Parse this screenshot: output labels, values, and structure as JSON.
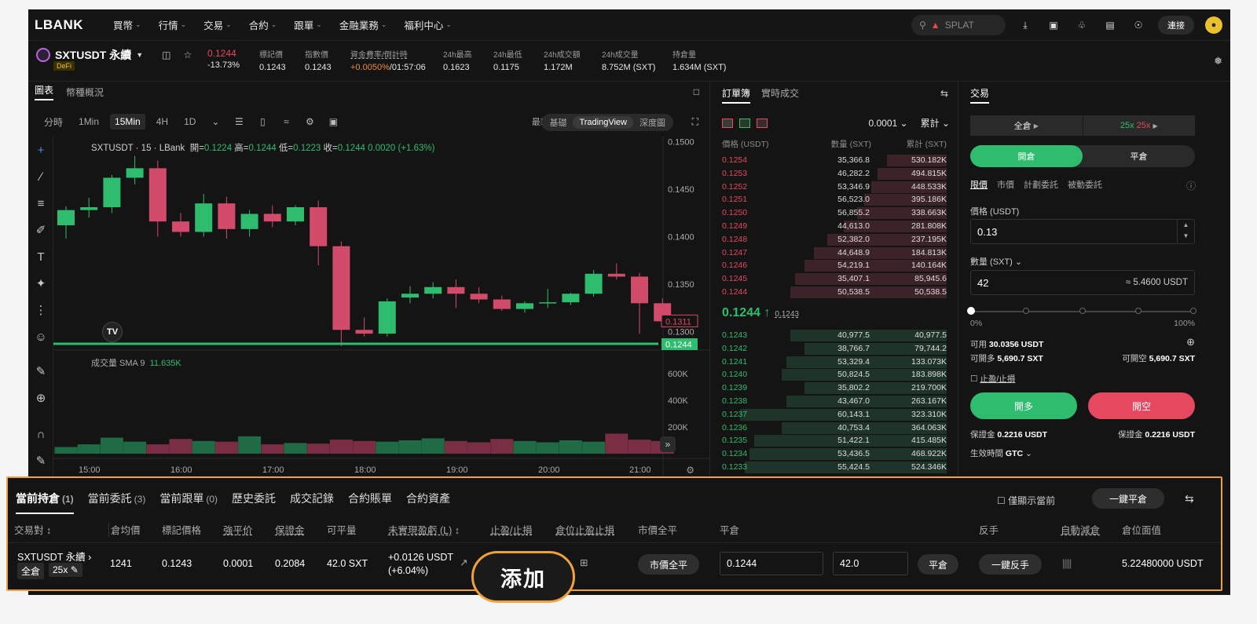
{
  "nav": {
    "logo": "LBANK",
    "items": [
      "買幣",
      "行情",
      "交易",
      "合約",
      "跟單",
      "金融業務",
      "福利中心"
    ],
    "search": "SPLAT",
    "connect": "連接"
  },
  "ticker": {
    "symbol": "SXTUSDT 永續",
    "badge": "DeFi",
    "price": "0.1244",
    "change": "-13.73%",
    "stats": [
      {
        "label": "標記價",
        "value": "0.1243"
      },
      {
        "label": "指數價",
        "value": "0.1243"
      },
      {
        "label": "資金費率/倒計時",
        "value": "+0.0050%",
        "value2": "/01:57:06"
      },
      {
        "label": "24h最高",
        "value": "0.1623"
      },
      {
        "label": "24h最低",
        "value": "0.1175"
      },
      {
        "label": "24h成交額",
        "value": "1.172M"
      },
      {
        "label": "24h成交量",
        "value": "8.752M (SXT)"
      },
      {
        "label": "持倉量",
        "value": "1.634M (SXT)"
      }
    ]
  },
  "chart_panel": {
    "tabs": [
      "圖表",
      "幣種概況"
    ],
    "timeframes": [
      "分時",
      "1Min",
      "15Min",
      "4H",
      "1D"
    ],
    "price_type": "最新價",
    "views": [
      "基礎",
      "TradingView",
      "深度圖"
    ]
  },
  "chart_data": {
    "type": "candlestick",
    "title": "SXTUSDT · 15 · LBank",
    "ohlc_legend": {
      "open": "0.1224",
      "high": "0.1244",
      "low": "0.1223",
      "close": "0.1244",
      "change": "0.0020 (+1.63%)"
    },
    "x_ticks": [
      "15:00",
      "16:00",
      "17:00",
      "18:00",
      "19:00",
      "20:00",
      "21:00"
    ],
    "y_ticks": [
      "0.1500",
      "0.1450",
      "0.1400",
      "0.1350",
      "0.1300"
    ],
    "ylim": [
      0.1289,
      0.1502
    ],
    "price_labels": {
      "crosshair": "0.1311",
      "last": "0.1244"
    },
    "candles": [
      {
        "o": 0.1412,
        "h": 0.1432,
        "l": 0.1398,
        "c": 0.1428
      },
      {
        "o": 0.1428,
        "h": 0.1441,
        "l": 0.142,
        "c": 0.1431
      },
      {
        "o": 0.1431,
        "h": 0.1465,
        "l": 0.1425,
        "c": 0.1462
      },
      {
        "o": 0.1462,
        "h": 0.1485,
        "l": 0.1455,
        "c": 0.1472
      },
      {
        "o": 0.1472,
        "h": 0.148,
        "l": 0.14,
        "c": 0.1416
      },
      {
        "o": 0.1416,
        "h": 0.1425,
        "l": 0.14,
        "c": 0.1405
      },
      {
        "o": 0.1405,
        "h": 0.1445,
        "l": 0.14,
        "c": 0.1435
      },
      {
        "o": 0.1435,
        "h": 0.1442,
        "l": 0.1398,
        "c": 0.1408
      },
      {
        "o": 0.1408,
        "h": 0.1428,
        "l": 0.14,
        "c": 0.1424
      },
      {
        "o": 0.1424,
        "h": 0.1433,
        "l": 0.141,
        "c": 0.1416
      },
      {
        "o": 0.1416,
        "h": 0.1433,
        "l": 0.1412,
        "c": 0.1431
      },
      {
        "o": 0.1431,
        "h": 0.1438,
        "l": 0.137,
        "c": 0.139
      },
      {
        "o": 0.139,
        "h": 0.1395,
        "l": 0.1285,
        "c": 0.1302
      },
      {
        "o": 0.1302,
        "h": 0.1315,
        "l": 0.1295,
        "c": 0.1298
      },
      {
        "o": 0.1298,
        "h": 0.1335,
        "l": 0.1295,
        "c": 0.1332
      },
      {
        "o": 0.1336,
        "h": 0.1348,
        "l": 0.133,
        "c": 0.134
      },
      {
        "o": 0.134,
        "h": 0.1352,
        "l": 0.1335,
        "c": 0.1347
      },
      {
        "o": 0.1347,
        "h": 0.1355,
        "l": 0.1325,
        "c": 0.134
      },
      {
        "o": 0.134,
        "h": 0.1347,
        "l": 0.133,
        "c": 0.1334
      },
      {
        "o": 0.1334,
        "h": 0.1338,
        "l": 0.1322,
        "c": 0.1324
      },
      {
        "o": 0.1324,
        "h": 0.1332,
        "l": 0.132,
        "c": 0.133
      },
      {
        "o": 0.133,
        "h": 0.1345,
        "l": 0.1325,
        "c": 0.1331
      },
      {
        "o": 0.1331,
        "h": 0.1341,
        "l": 0.1328,
        "c": 0.134
      },
      {
        "o": 0.134,
        "h": 0.1365,
        "l": 0.1337,
        "c": 0.1361
      },
      {
        "o": 0.1361,
        "h": 0.1372,
        "l": 0.1355,
        "c": 0.1358
      },
      {
        "o": 0.1358,
        "h": 0.1362,
        "l": 0.1298,
        "c": 0.133
      },
      {
        "o": 0.133,
        "h": 0.1335,
        "l": 0.1305,
        "c": 0.1311
      }
    ],
    "volume": {
      "label": "成交量 SMA 9",
      "value": "11.635K",
      "y_ticks": [
        "600K",
        "400K",
        "200K"
      ],
      "ylim": [
        0,
        700000
      ],
      "bars": [
        50000,
        70000,
        120000,
        90000,
        70000,
        110000,
        95000,
        90000,
        130000,
        70000,
        80000,
        75000,
        105000,
        95000,
        90000,
        100000,
        115000,
        95000,
        85000,
        110000,
        95000,
        85000,
        100000,
        90000,
        150000,
        105000,
        95000
      ]
    }
  },
  "orderbook": {
    "tabs": [
      "訂單簿",
      "實時成交"
    ],
    "precision": "0.0001",
    "mode": "累計",
    "headers": [
      "價格 (USDT)",
      "數量 (SXT)",
      "累計 (SXT)"
    ],
    "asks": [
      [
        "0.1254",
        "35,366.8",
        "530.182K"
      ],
      [
        "0.1253",
        "46,282.2",
        "494.815K"
      ],
      [
        "0.1252",
        "53,346.9",
        "448.533K"
      ],
      [
        "0.1251",
        "56,523.0",
        "395.186K"
      ],
      [
        "0.1250",
        "56,855.2",
        "338.663K"
      ],
      [
        "0.1249",
        "44,613.0",
        "281.808K"
      ],
      [
        "0.1248",
        "52,382.0",
        "237.195K"
      ],
      [
        "0.1247",
        "44,648.9",
        "184.813K"
      ],
      [
        "0.1246",
        "54,219.1",
        "140.164K"
      ],
      [
        "0.1245",
        "35,407.1",
        "85,945.6"
      ],
      [
        "0.1244",
        "50,538.5",
        "50,538.5"
      ]
    ],
    "mid": "0.1244",
    "mid_ref": "0.1243",
    "bids": [
      [
        "0.1243",
        "40,977.5",
        "40,977.5"
      ],
      [
        "0.1242",
        "38,766.7",
        "79,744.2"
      ],
      [
        "0.1241",
        "53,329.4",
        "133.073K"
      ],
      [
        "0.1240",
        "50,824.5",
        "183.898K"
      ],
      [
        "0.1239",
        "35,802.2",
        "219.700K"
      ],
      [
        "0.1238",
        "43,467.0",
        "263.167K"
      ],
      [
        "0.1237",
        "60,143.1",
        "323.310K"
      ],
      [
        "0.1236",
        "40,753.4",
        "364.063K"
      ],
      [
        "0.1235",
        "51,422.1",
        "415.485K"
      ],
      [
        "0.1234",
        "53,436.5",
        "468.922K"
      ],
      [
        "0.1233",
        "55,424.5",
        "524.346K"
      ]
    ],
    "ask_fill": [
      0.26,
      0.3,
      0.33,
      0.36,
      0.39,
      0.45,
      0.52,
      0.58,
      0.62,
      0.66,
      0.68
    ],
    "bid_fill": [
      0.68,
      0.62,
      0.7,
      0.72,
      0.62,
      0.7,
      0.9,
      0.72,
      0.84,
      0.86,
      0.88
    ]
  },
  "trade": {
    "title": "交易",
    "margin_mode": "全倉",
    "leverage_long": "25x",
    "leverage_short": "25x",
    "open": "開倉",
    "close": "平倉",
    "order_types": [
      "限價",
      "市價",
      "計劃委託",
      "被動委託"
    ],
    "price_label": "價格 (USDT)",
    "price_value": "0.13",
    "qty_label": "數量 (SXT)",
    "qty_value": "42",
    "qty_approx": "≈ 5.4600 USDT",
    "slider_min": "0%",
    "slider_max": "100%",
    "slider_value": 0,
    "available_label": "可用",
    "available": "30.0356 USDT",
    "can_long_label": "可開多",
    "can_long": "5,690.7 SXT",
    "can_short_label": "可開空",
    "can_short": "5,690.7 SXT",
    "tpsl": "止盈/止損",
    "long_btn": "開多",
    "short_btn": "開空",
    "margin_label": "保證金",
    "margin_long": "0.2216 USDT",
    "margin_short": "0.2216 USDT",
    "tif_label": "生效時間",
    "tif": "GTC"
  },
  "bottom": {
    "tabs": [
      {
        "label": "當前持倉",
        "count": "(1)"
      },
      {
        "label": "當前委託",
        "count": "(3)"
      },
      {
        "label": "當前跟單",
        "count": "(0)"
      },
      {
        "label": "歷史委託",
        "count": ""
      },
      {
        "label": "成交記錄",
        "count": ""
      },
      {
        "label": "合約賬單",
        "count": ""
      },
      {
        "label": "合約資產",
        "count": ""
      }
    ],
    "only_current": "僅顯示當前",
    "close_all": "一鍵平倉",
    "headers": [
      "交易對",
      "倉均價",
      "標記價格",
      "強平价",
      "保證金",
      "可平量",
      "未實現盈虧 (L)",
      "止盈/止損",
      "倉位止盈止損",
      "市價全平",
      "平倉",
      "反手",
      "自動減倉",
      "倉位面值"
    ],
    "row": {
      "pair": "SXTUSDT 永續",
      "mode": "全倉",
      "lev": "25x",
      "entry": "1241",
      "mark": "0.1243",
      "liq": "0.0001",
      "margin": "0.2084",
      "closable": "42.0 SXT",
      "pnl": "+0.0126 USDT",
      "pnl_pct": "(+6.04%)",
      "market_close": "市價全平",
      "close_price": "0.1244",
      "close_qty": "42.0",
      "close_btn": "平倉",
      "reverse": "一鍵反手",
      "notional": "5.22480000 USDT"
    }
  },
  "overlay": {
    "label": "添加"
  }
}
